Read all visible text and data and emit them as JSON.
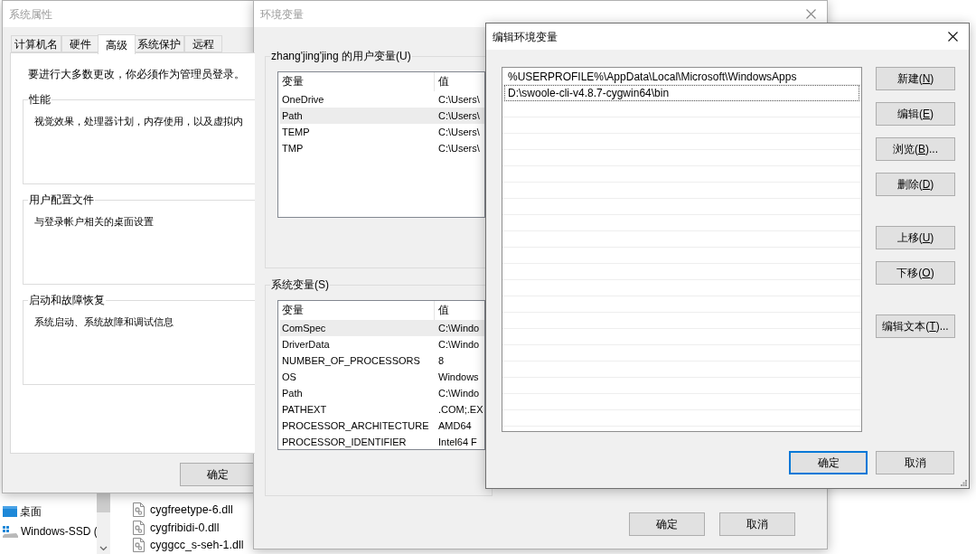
{
  "explorer": {
    "sidebar_items": [
      {
        "label": "桌面",
        "kind": "desktop"
      },
      {
        "label": "Windows-SSD (",
        "kind": "drive"
      }
    ],
    "files": [
      "cygfreetype-6.dll",
      "cygfribidi-0.dll",
      "cyggcc_s-seh-1.dll"
    ]
  },
  "system_properties": {
    "title": "系统属性",
    "active": false,
    "tabs": [
      {
        "label": "计算机名",
        "selected": false
      },
      {
        "label": "硬件",
        "selected": false
      },
      {
        "label": "高级",
        "selected": true
      },
      {
        "label": "系统保护",
        "selected": false
      },
      {
        "label": "远程",
        "selected": false
      }
    ],
    "notice": "要进行大多数更改，你必须作为管理员登录。",
    "groups": [
      {
        "label": "性能",
        "description": "视觉效果，处理器计划，内存使用，以及虚拟内"
      },
      {
        "label": "用户配置文件",
        "description": "与登录帐户相关的桌面设置"
      },
      {
        "label": "启动和故障恢复",
        "description": "系统启动、系统故障和调试信息"
      }
    ],
    "buttons": [
      "确定"
    ]
  },
  "environment_variables": {
    "title": "环境变量",
    "active": false,
    "user_variables": {
      "label": "zhang'jing'jing 的用户变量(U)",
      "columns": [
        "变量",
        "值"
      ],
      "rows": [
        {
          "name": "OneDrive",
          "value": "C:\\Users\\",
          "selected": false
        },
        {
          "name": "Path",
          "value": "C:\\Users\\",
          "selected": true
        },
        {
          "name": "TEMP",
          "value": "C:\\Users\\",
          "selected": false
        },
        {
          "name": "TMP",
          "value": "C:\\Users\\",
          "selected": false
        }
      ]
    },
    "system_variables": {
      "label": "系统变量(S)",
      "columns": [
        "变量",
        "值"
      ],
      "rows": [
        {
          "name": "ComSpec",
          "value": "C:\\Windo",
          "selected": true
        },
        {
          "name": "DriverData",
          "value": "C:\\Windo",
          "selected": false
        },
        {
          "name": "NUMBER_OF_PROCESSORS",
          "value": "8",
          "selected": false
        },
        {
          "name": "OS",
          "value": "Windows",
          "selected": false
        },
        {
          "name": "Path",
          "value": "C:\\Windo",
          "selected": false
        },
        {
          "name": "PATHEXT",
          "value": ".COM;.EX",
          "selected": false
        },
        {
          "name": "PROCESSOR_ARCHITECTURE",
          "value": "AMD64",
          "selected": false
        },
        {
          "name": "PROCESSOR_IDENTIFIER",
          "value": "Intel64 F",
          "selected": false
        }
      ]
    },
    "buttons": [
      "确定",
      "取消"
    ]
  },
  "edit_variable": {
    "title": "编辑环境变量",
    "active": true,
    "entries": [
      {
        "text": "%USERPROFILE%\\AppData\\Local\\Microsoft\\WindowsApps",
        "focused": false
      },
      {
        "text": "D:\\swoole-cli-v4.8.7-cygwin64\\bin",
        "focused": true
      }
    ],
    "side_button_groups": [
      [
        {
          "label_before": "新建(",
          "access_key": "N",
          "label_after": ")"
        },
        {
          "label_before": "编辑(",
          "access_key": "E",
          "label_after": ")"
        },
        {
          "label_before": "浏览(",
          "access_key": "B",
          "label_after": ")..."
        },
        {
          "label_before": "删除(",
          "access_key": "D",
          "label_after": ")"
        }
      ],
      [
        {
          "label_before": "上移(",
          "access_key": "U",
          "label_after": ")"
        },
        {
          "label_before": "下移(",
          "access_key": "O",
          "label_after": ")"
        }
      ],
      [
        {
          "label_before": "编辑文本(",
          "access_key": "T",
          "label_after": ")..."
        }
      ]
    ],
    "buttons": [
      {
        "label": "确定",
        "default": true
      },
      {
        "label": "取消",
        "default": false
      }
    ]
  }
}
